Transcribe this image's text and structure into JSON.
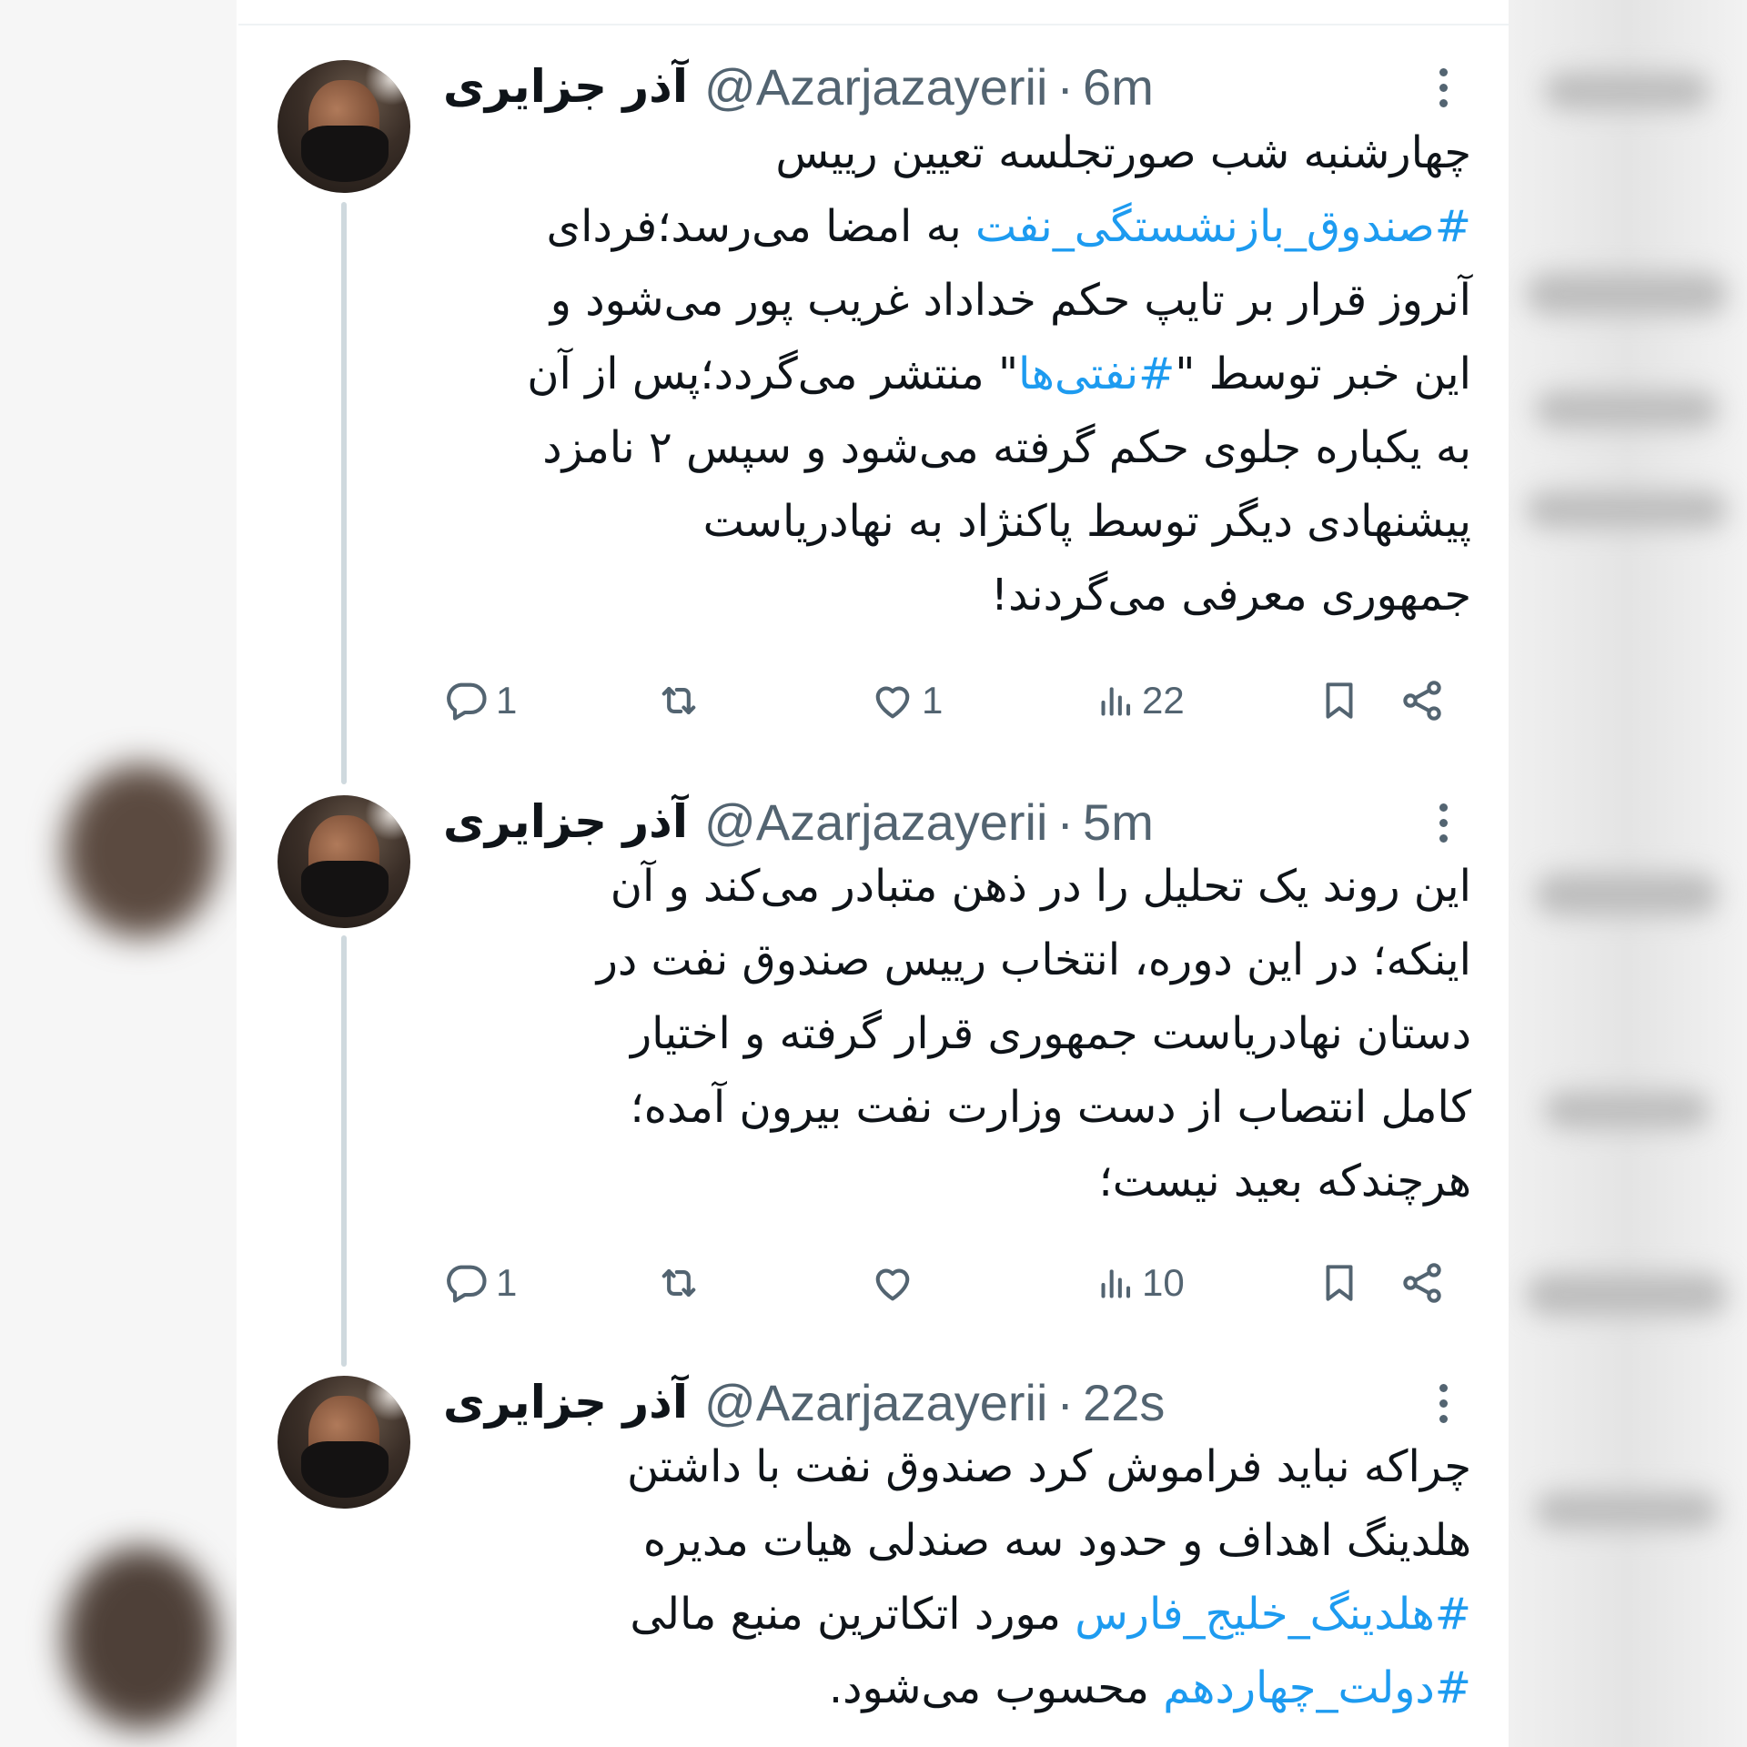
{
  "tweets": [
    {
      "display_name": "آذر جزایری",
      "handle": "@Azarjazayerii",
      "separator": "·",
      "time": "6m",
      "lines": [
        [
          {
            "t": "چهارشنبه شب صورتجلسه تعیین رییس",
            "tag": false
          }
        ],
        [
          {
            "t": "#صندوق_بازنشستگی_نفت",
            "tag": true
          },
          {
            "t": " به امضا می‌رسد؛فردای",
            "tag": false
          }
        ],
        [
          {
            "t": "آنروز قرار بر تایپ حکم خداداد غریب پور می‌شود و",
            "tag": false
          }
        ],
        [
          {
            "t": "این خبر توسط \"",
            "tag": false
          },
          {
            "t": "#نفتی‌ها",
            "tag": true
          },
          {
            "t": "\" منتشر می‌گردد؛پس از آن",
            "tag": false
          }
        ],
        [
          {
            "t": "به یکباره جلوی حکم گرفته می‌شود و سپس ۲ نامزد",
            "tag": false
          }
        ],
        [
          {
            "t": "پیشنهادی دیگر توسط پاکنژاد به نهادریاست",
            "tag": false
          }
        ],
        [
          {
            "t": "جمهوری معرفی می‌گردند!",
            "tag": false
          }
        ]
      ],
      "actions": {
        "reply_count": "1",
        "retweet_count": "",
        "like_count": "1",
        "view_count": "22"
      }
    },
    {
      "display_name": "آذر جزایری",
      "handle": "@Azarjazayerii",
      "separator": "·",
      "time": "5m",
      "lines": [
        [
          {
            "t": "این روند یک تحلیل را در ذهن متبادر می‌کند و آن",
            "tag": false
          }
        ],
        [
          {
            "t": "اینکه؛ در این دوره، انتخاب رییس صندوق نفت در",
            "tag": false
          }
        ],
        [
          {
            "t": "دستان نهادریاست جمهوری قرار گرفته و اختیار",
            "tag": false
          }
        ],
        [
          {
            "t": "کامل انتصاب از دست وزارت نفت بیرون آمده؛",
            "tag": false
          }
        ],
        [
          {
            "t": "هرچندکه بعید نیست؛",
            "tag": false
          }
        ]
      ],
      "actions": {
        "reply_count": "1",
        "retweet_count": "",
        "like_count": "",
        "view_count": "10"
      }
    },
    {
      "display_name": "آذر جزایری",
      "handle": "@Azarjazayerii",
      "separator": "·",
      "time": "22s",
      "lines": [
        [
          {
            "t": "چراکه نباید فراموش کرد صندوق نفت با داشتن",
            "tag": false
          }
        ],
        [
          {
            "t": "هلدینگ اهداف و حدود سه صندلی هیات مدیره",
            "tag": false
          }
        ],
        [
          {
            "t": "#هلدینگ_خلیج_فارس",
            "tag": true
          },
          {
            "t": " مورد اتکاترین منبع مالی",
            "tag": false
          }
        ],
        [
          {
            "t": "#دولت_چهاردهم",
            "tag": true
          },
          {
            "t": " محسوب می‌شود.",
            "tag": false
          }
        ]
      ],
      "actions": null
    }
  ],
  "colors": {
    "hashtag": "#1d9bf0",
    "secondary_text": "#536471",
    "primary_text": "#0f1419",
    "thread_line": "#cfd9de"
  },
  "icons": [
    "reply-icon",
    "retweet-icon",
    "like-icon",
    "views-icon",
    "bookmark-icon",
    "share-icon",
    "more-icon"
  ]
}
